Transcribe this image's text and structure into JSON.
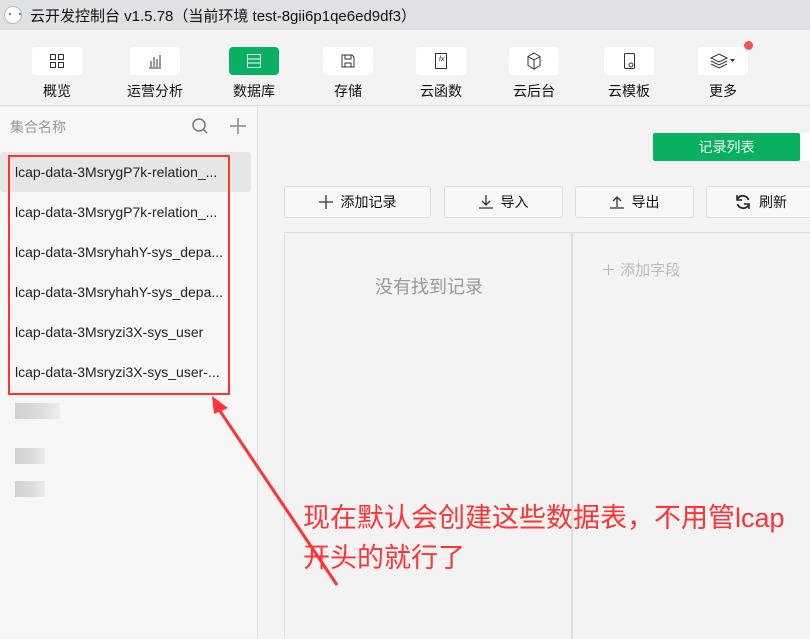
{
  "window": {
    "title": "云开发控制台 v1.5.78（当前环境 test-8gii6p1qe6ed9df3）"
  },
  "toolbar": [
    {
      "label": "概览",
      "icon": "grid-icon"
    },
    {
      "label": "运营分析",
      "icon": "bar-chart-icon"
    },
    {
      "label": "数据库",
      "icon": "database-icon",
      "active": true
    },
    {
      "label": "存储",
      "icon": "floppy-icon"
    },
    {
      "label": "云函数",
      "icon": "function-icon"
    },
    {
      "label": "云后台",
      "icon": "cube-icon"
    },
    {
      "label": "云模板",
      "icon": "template-icon"
    },
    {
      "label": "更多",
      "icon": "layers-icon",
      "badge": true
    }
  ],
  "sidebar": {
    "header": "集合名称",
    "items": [
      "lcap-data-3MsrygP7k-relation_...",
      "lcap-data-3MsrygP7k-relation_...",
      "lcap-data-3MsryhahY-sys_depa...",
      "lcap-data-3MsryhahY-sys_depa...",
      "lcap-data-3Msryzi3X-sys_user",
      "lcap-data-3Msryzi3X-sys_user-..."
    ]
  },
  "main": {
    "tab": "记录列表",
    "buttons": {
      "add": "添加记录",
      "import": "导入",
      "export": "导出",
      "refresh": "刷新"
    },
    "empty": "没有找到记录",
    "add_field": "添加字段"
  },
  "annotation": {
    "text": "现在默认会创建这些数据表，不用管lcap开头的就行了",
    "color": "#ff3333"
  },
  "colors": {
    "accent": "#08b061"
  }
}
